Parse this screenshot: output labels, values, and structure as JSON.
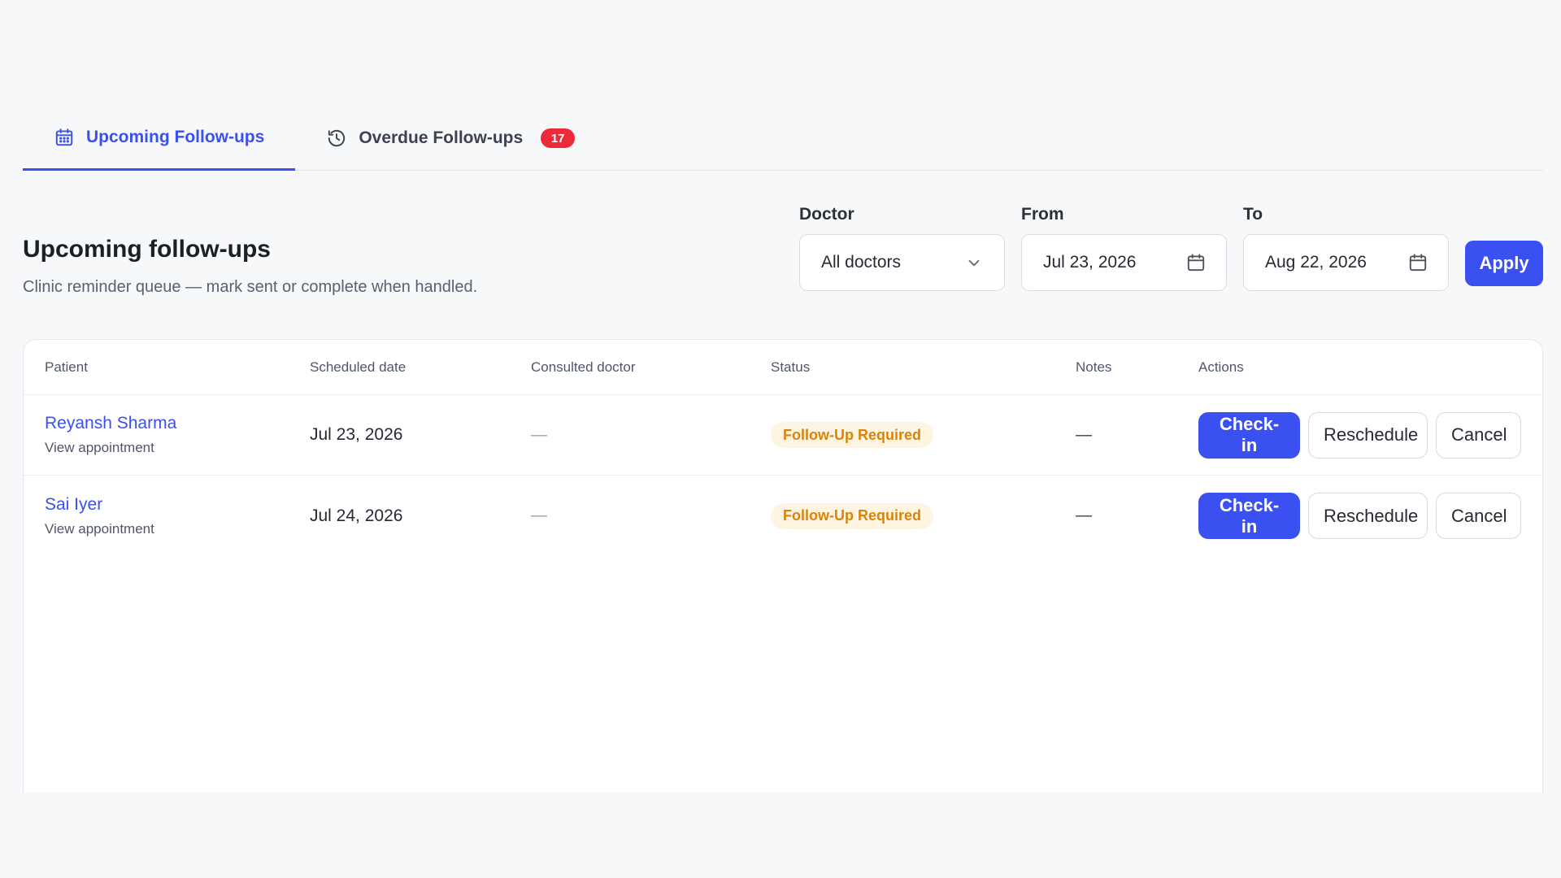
{
  "tabs": [
    {
      "label": "Upcoming Follow-ups",
      "icon": "calendar-icon",
      "active": true
    },
    {
      "label": "Overdue Follow-ups",
      "icon": "history-icon",
      "badge": "17",
      "active": false
    }
  ],
  "colors": {
    "accent": "#3b50f0",
    "badge": "#ee2a3a",
    "status_bg": "#fdf5e1",
    "status_fg": "#d8840a"
  },
  "header": {
    "title": "Upcoming follow-ups",
    "subtitle": "Clinic reminder queue — mark sent or complete when handled."
  },
  "filters": {
    "doctor": {
      "label": "Doctor",
      "value": "All doctors"
    },
    "from": {
      "label": "From",
      "value": "Jul 23, 2026"
    },
    "to": {
      "label": "To",
      "value": "Aug 22, 2026"
    },
    "apply_label": "Apply"
  },
  "table": {
    "columns": [
      "Patient",
      "Scheduled date",
      "Consulted doctor",
      "Status",
      "Notes",
      "Actions"
    ],
    "rows": [
      {
        "patient": "Reyansh Sharma",
        "link": "View appointment",
        "date": "Jul 23, 2026",
        "doctor": "—",
        "status": "Follow-Up Required",
        "notes": "—"
      },
      {
        "patient": "Sai Iyer",
        "link": "View appointment",
        "date": "Jul 24, 2026",
        "doctor": "—",
        "status": "Follow-Up Required",
        "notes": "—"
      }
    ],
    "actions": {
      "checkin": "Check-in",
      "reschedule": "Reschedule",
      "cancel": "Cancel"
    }
  }
}
